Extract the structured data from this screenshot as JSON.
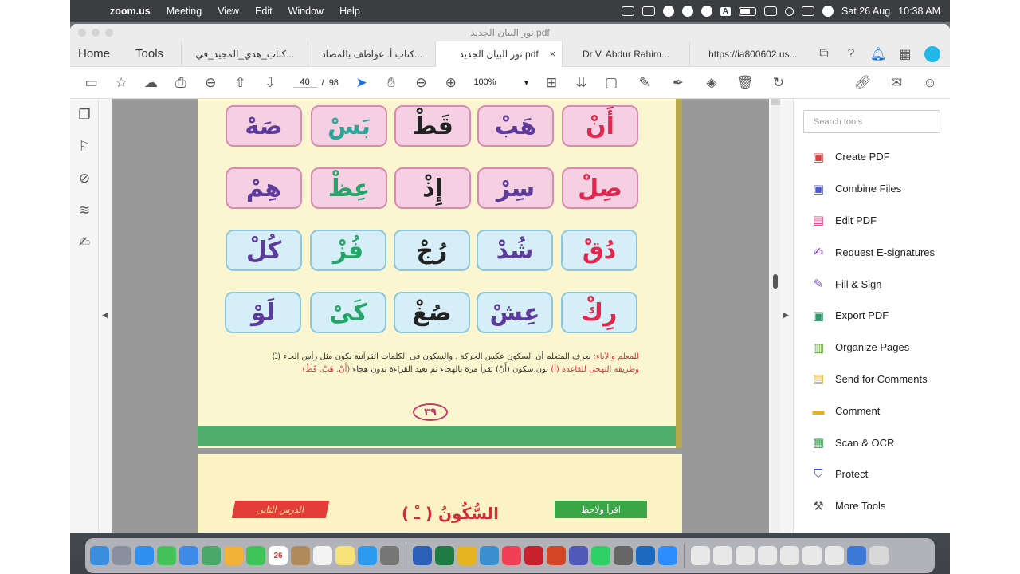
{
  "menubar": {
    "app_name": "zoom.us",
    "items": [
      "Meeting",
      "View",
      "Edit",
      "Window",
      "Help"
    ],
    "date": "Sat 26 Aug",
    "time": "10:38 AM",
    "input_indicator": "A"
  },
  "window": {
    "title": "نور البيان الجديد.pdf"
  },
  "tabbar": {
    "home": "Home",
    "tools": "Tools",
    "tabs": [
      {
        "label": "كتاب_هدي_المجيد_في..."
      },
      {
        "label": "كتاب أ. عواطف بالمصاد..."
      },
      {
        "label": "نور البيان الجديد.pdf"
      },
      {
        "label": "Dr V. Abdur Rahim..."
      },
      {
        "label": "https://ia800602.us..."
      }
    ],
    "close_symbol": "×"
  },
  "toolbar": {
    "current_page": "40",
    "page_sep": "/",
    "total_pages": "98",
    "zoom": "100%"
  },
  "document": {
    "rows": [
      [
        "صَهْ",
        "بَسْ",
        "قَطْ",
        "هَبْ",
        "أَنْ"
      ],
      [
        "هِمْ",
        "عِظْ",
        "إِذْ",
        "سِرْ",
        "صِلْ"
      ],
      [
        "كُلْ",
        "فُزْ",
        "رُجْ",
        "شُدْ",
        "دُقْ"
      ],
      [
        "لَوْ",
        "كَىْ",
        "صُغْ",
        "عِشْ",
        "رِكْ"
      ]
    ],
    "note_lead": "للمعلم والآباء:",
    "note_line1": "يعرف المتعلم أن السكون عكس الحركة . والسكون فى الكلمات القرآنية يكون مثل رأس الحاء (ـْ)",
    "note_line2_red": "وطريقة التهجى للقاعدة (أ)",
    "note_line2": "نون سكون (أَنْ) تقرأ مرة بالهجاء ثم نعيد القراءة بدون هجاء",
    "note_line2_tail": "(أَنْ. هَبْ. قَطْ)",
    "page_number": "٣٩",
    "page2_left_label": "الدرس الثانى",
    "page2_title": "السُّكُونُ ( ـْ )",
    "page2_right_label": "اقرأ ولاحظ"
  },
  "tools_panel": {
    "search_placeholder": "Search tools",
    "items": [
      {
        "label": "Create PDF",
        "color": "#e0413c"
      },
      {
        "label": "Combine Files",
        "color": "#4f5ccf"
      },
      {
        "label": "Edit PDF",
        "color": "#d83c7c"
      },
      {
        "label": "Request E-signatures",
        "color": "#8b45c4"
      },
      {
        "label": "Fill & Sign",
        "color": "#7b45c4"
      },
      {
        "label": "Export PDF",
        "color": "#2f9b6b"
      },
      {
        "label": "Organize Pages",
        "color": "#63a83b"
      },
      {
        "label": "Send for Comments",
        "color": "#e3ad1c"
      },
      {
        "label": "Comment",
        "color": "#e3b21c"
      },
      {
        "label": "Scan & OCR",
        "color": "#2f9b4b"
      },
      {
        "label": "Protect",
        "color": "#3f50b5"
      },
      {
        "label": "More Tools",
        "color": "#555555"
      }
    ]
  },
  "dock": {
    "calendar_day": "26"
  }
}
